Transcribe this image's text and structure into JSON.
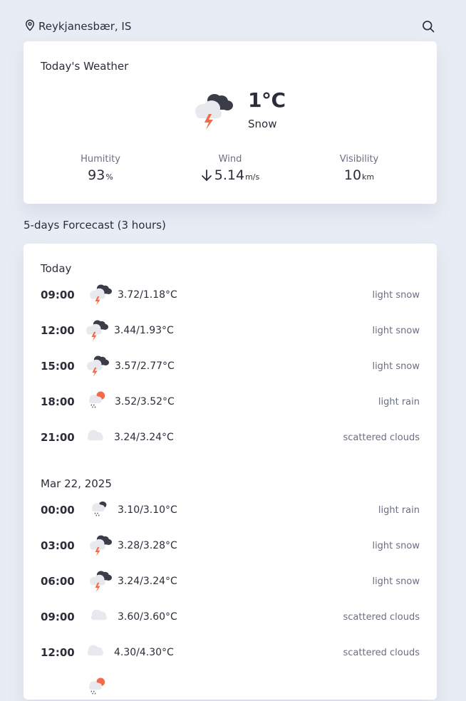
{
  "header": {
    "location": "Reykjanesbær, IS",
    "location_icon": "map-pin-icon",
    "search_icon": "search-icon"
  },
  "today": {
    "title": "Today's Weather",
    "icon": "thunder-snow-icon",
    "temperature": "1°C",
    "condition": "Snow",
    "humidity": {
      "label": "Humitity",
      "value": "93",
      "unit": "%"
    },
    "wind": {
      "label": "Wind",
      "value": "5.14",
      "unit": "m/s",
      "direction_icon": "arrow-down-icon"
    },
    "visibility": {
      "label": "Visibility",
      "value": "10",
      "unit": "km"
    }
  },
  "forecast": {
    "title": "5-days Forcecast (3 hours)",
    "groups": [
      {
        "date": "Today",
        "rows": [
          {
            "time": "09:00",
            "range": "3.72/1.18°C",
            "desc": "light snow",
            "icon": "thunder-snow-icon"
          },
          {
            "time": "12:00",
            "range": "3.44/1.93°C",
            "desc": "light snow",
            "icon": "thunder-snow-icon"
          },
          {
            "time": "15:00",
            "range": "3.57/2.77°C",
            "desc": "light snow",
            "icon": "thunder-snow-icon"
          },
          {
            "time": "18:00",
            "range": "3.52/3.52°C",
            "desc": "light rain",
            "icon": "sun-rain-icon"
          },
          {
            "time": "21:00",
            "range": "3.24/3.24°C",
            "desc": "scattered clouds",
            "icon": "cloud-icon"
          }
        ]
      },
      {
        "date": "Mar 22, 2025",
        "rows": [
          {
            "time": "00:00",
            "range": "3.10/3.10°C",
            "desc": "light rain",
            "icon": "cloud-rain-icon"
          },
          {
            "time": "03:00",
            "range": "3.28/3.28°C",
            "desc": "light snow",
            "icon": "thunder-snow-icon"
          },
          {
            "time": "06:00",
            "range": "3.24/3.24°C",
            "desc": "light snow",
            "icon": "thunder-snow-icon"
          },
          {
            "time": "09:00",
            "range": "3.60/3.60°C",
            "desc": "scattered clouds",
            "icon": "cloud-icon"
          },
          {
            "time": "12:00",
            "range": "4.30/4.30°C",
            "desc": "scattered clouds",
            "icon": "cloud-icon"
          }
        ]
      }
    ]
  },
  "colors": {
    "background": "#e8ecf4",
    "card": "#ffffff",
    "text": "#2b2d3a",
    "muted": "#6a6e82",
    "lightning": "#f06a4c",
    "sun": "#f06a4c"
  }
}
